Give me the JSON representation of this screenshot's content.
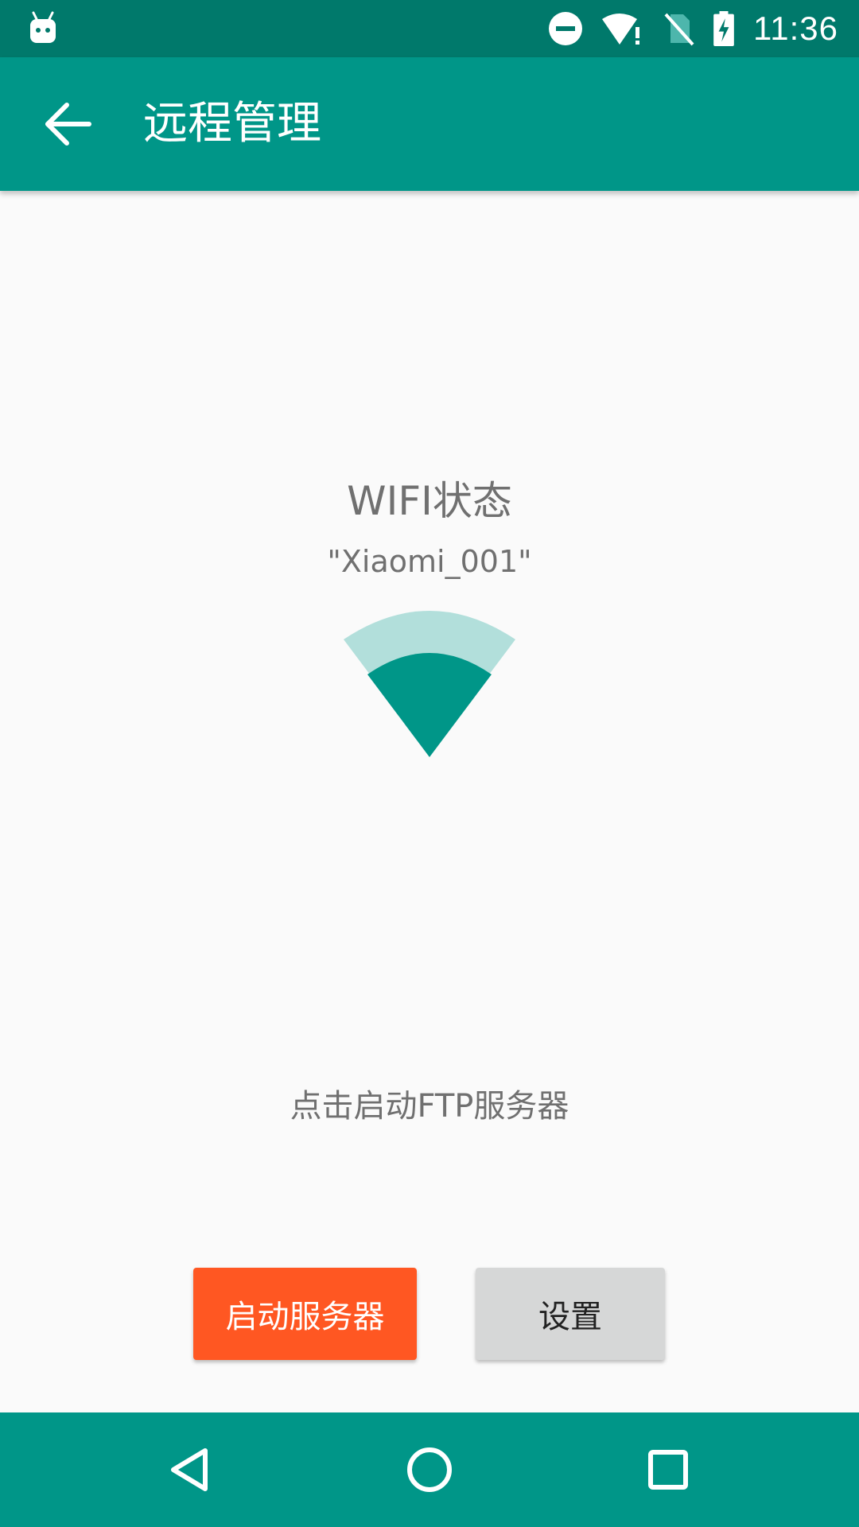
{
  "status_bar": {
    "time": "11:36",
    "icons": [
      "android-robot-icon",
      "do-not-disturb-icon",
      "wifi-alert-icon",
      "no-sim-icon",
      "battery-charging-icon"
    ]
  },
  "app_bar": {
    "title": "远程管理",
    "back_icon": "arrow-back-icon"
  },
  "wifi": {
    "title": "WIFI状态",
    "ssid": "\"Xiaomi_001\"",
    "signal_icon": "wifi-signal-icon"
  },
  "hint": "点击启动FTP服务器",
  "buttons": {
    "start": "启动服务器",
    "settings": "设置"
  },
  "nav_bar": {
    "icons": [
      "back-triangle-icon",
      "home-circle-icon",
      "recents-square-icon"
    ]
  },
  "colors": {
    "status_bar": "#00796B",
    "primary": "#009688",
    "accent": "#FF5722",
    "wifi_light": "#B2DFDB"
  }
}
